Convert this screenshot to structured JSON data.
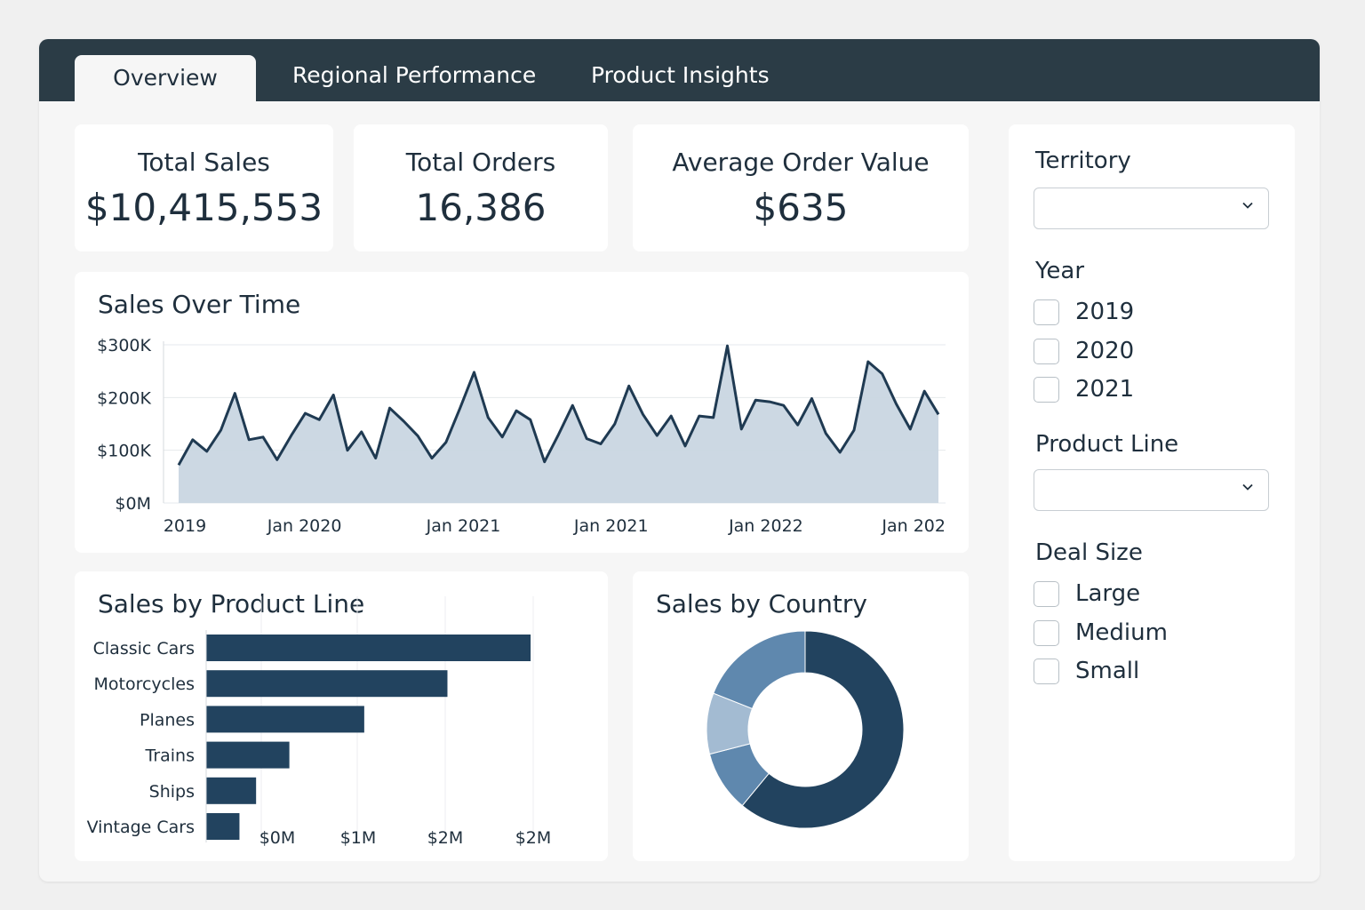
{
  "tabs": [
    {
      "label": "Overview",
      "active": true
    },
    {
      "label": "Regional Performance",
      "active": false
    },
    {
      "label": "Product Insights",
      "active": false
    }
  ],
  "kpis": [
    {
      "label": "Total Sales",
      "value": "$10,415,553"
    },
    {
      "label": "Total Orders",
      "value": "16,386"
    },
    {
      "label": "Average Order Value",
      "value": "$635"
    }
  ],
  "filters": {
    "territory": {
      "label": "Territory",
      "value": ""
    },
    "year": {
      "label": "Year",
      "options": [
        "2019",
        "2020",
        "2021"
      ]
    },
    "product_line": {
      "label": "Product Line",
      "value": ""
    },
    "deal_size": {
      "label": "Deal Size",
      "options": [
        "Large",
        "Medium",
        "Small"
      ]
    }
  },
  "colors": {
    "navy": "#22435f",
    "line": "#1f3a52",
    "area": "#c9d6e1",
    "mid": "#5f88ae",
    "light": "#a3bbd2"
  },
  "chart_data": [
    {
      "type": "area",
      "title": "Sales Over Time",
      "y_ticks": [
        "$0M",
        "$100K",
        "$200K",
        "$300K"
      ],
      "ylim": [
        0,
        300000
      ],
      "x_ticks": [
        {
          "label": "2019",
          "x": 0
        },
        {
          "label": "Jan 2020",
          "x": 8.5
        },
        {
          "label": "Jan 2021",
          "x": 19.8
        },
        {
          "label": "Jan 2021",
          "x": 30.3
        },
        {
          "label": "Jan 2022",
          "x": 41.3
        },
        {
          "label": "Jan 202",
          "x": 51.8
        }
      ],
      "x_max": 55,
      "values": [
        72000,
        120000,
        98000,
        138000,
        208000,
        120000,
        125000,
        82000,
        128000,
        170000,
        158000,
        205000,
        100000,
        135000,
        85000,
        180000,
        155000,
        127000,
        85000,
        115000,
        180000,
        248000,
        162000,
        125000,
        175000,
        158000,
        78000,
        130000,
        185000,
        122000,
        112000,
        150000,
        222000,
        168000,
        128000,
        165000,
        108000,
        165000,
        162000,
        298000,
        140000,
        195000,
        192000,
        185000,
        148000,
        198000,
        132000,
        96000,
        138000,
        268000,
        245000,
        188000,
        140000,
        212000,
        168000
      ]
    },
    {
      "type": "bar",
      "title": "Sales by Product Line",
      "categories": [
        "Classic Cars",
        "Motorcycles",
        "Planes",
        "Trains",
        "Ships",
        "Vintage Cars"
      ],
      "values": [
        3.9,
        2.9,
        1.9,
        1.0,
        0.6,
        0.4
      ],
      "x_ticks": [
        "$0M",
        "$1M",
        "$2M",
        "$2M"
      ]
    },
    {
      "type": "pie",
      "title": "Sales by Country",
      "slices": [
        {
          "value": 61,
          "color": "#22435f"
        },
        {
          "value": 10,
          "color": "#5f88ae"
        },
        {
          "value": 10,
          "color": "#a3bbd2"
        },
        {
          "value": 19,
          "color": "#5f88ae"
        }
      ]
    }
  ]
}
